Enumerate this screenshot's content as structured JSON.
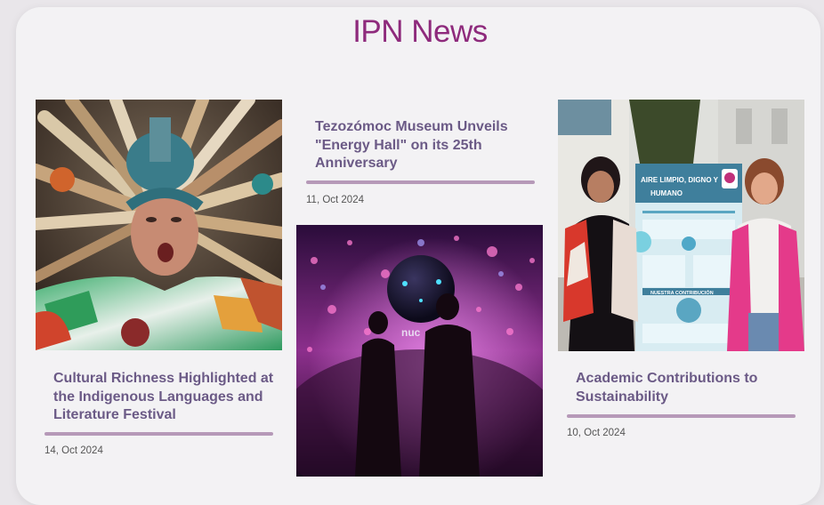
{
  "header": {
    "title": "IPN News"
  },
  "articles": [
    {
      "headline": "Cultural Richness Highlighted at the Indigenous Languages and Literature Festival",
      "date": "14, Oct 2024",
      "image": "feathered-headdress-performer"
    },
    {
      "headline": "Tezozómoc Museum Unveils \"Energy Hall\" on its 25th Anniversary",
      "date": "11, Oct 2024",
      "image": "museum-silhouettes-purple-lights"
    },
    {
      "headline": "Academic Contributions to Sustainability",
      "date": "10, Oct 2024",
      "image": "women-with-poster"
    }
  ],
  "poster": {
    "title_line1": "AIRE LIMPIO, DIGNO Y",
    "title_line2": "HUMANO",
    "section": "NUESTRA CONTRIBUCIÓN"
  },
  "museum_sign": "nuc"
}
